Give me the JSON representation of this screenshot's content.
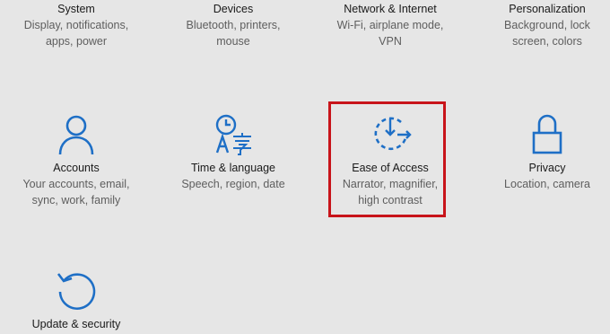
{
  "tiles": [
    {
      "title": "System",
      "desc": "Display, notifications, apps, power",
      "icon": "monitor-icon"
    },
    {
      "title": "Devices",
      "desc": "Bluetooth, printers, mouse",
      "icon": "keyboard-icon"
    },
    {
      "title": "Network & Internet",
      "desc": "Wi-Fi, airplane mode, VPN",
      "icon": "globe-icon"
    },
    {
      "title": "Personalization",
      "desc": "Background, lock screen, colors",
      "icon": "paintbrush-icon"
    },
    {
      "title": "Accounts",
      "desc": "Your accounts, email, sync, work, family",
      "icon": "person-icon"
    },
    {
      "title": "Time & language",
      "desc": "Speech, region, date",
      "icon": "clock-language-icon"
    },
    {
      "title": "Ease of Access",
      "desc": "Narrator, magnifier, high contrast",
      "icon": "ease-of-access-icon"
    },
    {
      "title": "Privacy",
      "desc": "Location, camera",
      "icon": "lock-icon"
    },
    {
      "title": "Update & security",
      "desc": "",
      "icon": "refresh-icon"
    }
  ],
  "colors": {
    "accent": "#1e6fc6",
    "background": "#e6e6e6",
    "highlight_border": "#c8141a"
  }
}
